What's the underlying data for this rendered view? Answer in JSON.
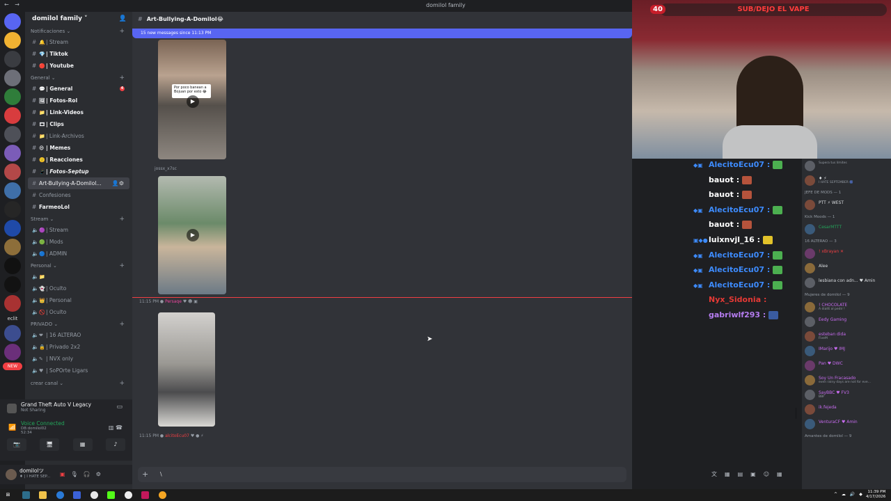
{
  "window": {
    "nav": "← →",
    "title": "domilol family"
  },
  "colors": {
    "accent": "#5865f2",
    "unread_badge": "#f23f43",
    "voice_green": "#23a55a",
    "webcam_banner_text": "#ff3b3b"
  },
  "servers": {
    "new_label": "NEW",
    "text_label": "eclit"
  },
  "guild": {
    "name": "domilol family ˅"
  },
  "categories": {
    "notificaciones": "Notificaciones ⌄",
    "general": "General ⌄",
    "stream": "Stream ⌄",
    "personal": "Personal ⌄",
    "privado": "PRIVADO ⌄",
    "crear": "crear canal ⌄"
  },
  "channels": {
    "stream": "| Stream",
    "tiktok": "| Tiktok",
    "youtube": "| Youtube",
    "general": "| General",
    "fotos_rol": "| Fotos-Rol",
    "link_videos": "| Link-Videos",
    "clips": "| Clips",
    "link_archivos": "| Link-Archivos",
    "memes": "| Memes",
    "reacciones": "| Reacciones",
    "fotos_septup": "| Fotos-Septup",
    "art_bullying": "Art-Bullying-A-Domilol...",
    "confesiones": "Confesiones",
    "farmeolol": "FarmeoLol",
    "v_stream": "| Stream",
    "v_mods": "| Mods",
    "v_admin": "| ADMIN",
    "p_oculto1": "| Oculto",
    "p_personal": "| Personal",
    "p_oculto2": "| Oculto",
    "pr_alterao": "| 16 ALTERAO",
    "pr_privado": "| Privado 2x2",
    "pr_nvx": "| NVX only",
    "pr_soporte": "| SoPOrte Ligars"
  },
  "activity": {
    "game": "Grand Theft Auto V Legacy",
    "sub": "Not Sharing"
  },
  "voice": {
    "status": "Voice Connected",
    "sub": "D8:domilol02",
    "time": "52:34"
  },
  "user": {
    "name": "domilolツ",
    "status": "♦ | I HATE SEP..."
  },
  "chat": {
    "header": "Art-Bullying-A-Domilol😂",
    "newbar": "15 new messages since 11:13 PM",
    "caption": "Por poco banean a Bojuan por esto 😂",
    "user1": "jossx_x7sc",
    "meta1_time": "11:15 PM",
    "meta1_author": "Persaqe",
    "meta2_time": "11:15 PM",
    "meta2_author": "alcitoEcu07",
    "composer_text": "\\"
  },
  "webcam": {
    "count": "40",
    "banner": "SUB/DEJO EL VAPE"
  },
  "twitch_chat": [
    {
      "badges": "◆▣",
      "user": "AlecitoEcu07 :",
      "color": "#3d8bfd",
      "emote": "#4caf50"
    },
    {
      "badges": "",
      "user": "bauot :",
      "color": "#ffffff",
      "emote": "#b5533c"
    },
    {
      "badges": "",
      "user": "bauot :",
      "color": "#ffffff",
      "emote": "#b5533c"
    },
    {
      "badges": "◆▣",
      "user": "AlecitoEcu07 :",
      "color": "#3d8bfd",
      "emote": "#4caf50"
    },
    {
      "badges": "",
      "user": "bauot :",
      "color": "#ffffff",
      "emote": "#b5533c"
    },
    {
      "badges": "▣◆●",
      "user": "luixnvjl_16 :",
      "color": "#ffffff",
      "emote": "#e2c22a"
    },
    {
      "badges": "◆▣",
      "user": "AlecitoEcu07 :",
      "color": "#3d8bfd",
      "emote": "#4caf50"
    },
    {
      "badges": "◆▣",
      "user": "AlecitoEcu07 :",
      "color": "#3d8bfd",
      "emote": "#4caf50"
    },
    {
      "badges": "◆▣",
      "user": "AlecitoEcu07 :",
      "color": "#3d8bfd",
      "emote": "#4caf50"
    },
    {
      "badges": "",
      "user": "Nyx_Sidonia :",
      "color": "#e53935",
      "emote": ""
    },
    {
      "badges": "",
      "user": "gabriwlf293 :",
      "color": "#b57cf0",
      "emote": "#3a5ba0"
    }
  ],
  "members": {
    "g1": "JEFE DE MODS — 1",
    "g2": "Kick Moods — 1",
    "g3": "16 ALTERAO — 3",
    "g4": "Mujeres de domilol — 9",
    "g5": "Amantes de domilol — 9",
    "list1": [
      {
        "name": "",
        "sub": "Supera tus límites"
      },
      {
        "name": "♦ ⚡",
        "sub": "I HATE SEPTEMBER 🎆"
      }
    ],
    "list2": [
      {
        "name": "PTT ⚡ WEST",
        "sub": ""
      }
    ],
    "list3": [
      {
        "name": "CesarMTTT",
        "sub": ""
      }
    ],
    "list4": [
      {
        "name": "! xBrayan ✕",
        "sub": ""
      },
      {
        "name": "Alee",
        "sub": ""
      },
      {
        "name": "lesbiana con adn... ♥ Amin",
        "sub": ""
      }
    ],
    "list5": [
      {
        "name": "! CHOCOLATE",
        "sub": "A dialtt al pedir !"
      },
      {
        "name": "Eedy Gaming",
        "sub": ""
      },
      {
        "name": "esteban dida",
        "sub": "FiveM"
      },
      {
        "name": "IMarijo ♥ IMJ",
        "sub": ""
      },
      {
        "name": "Pan ♥ DWC",
        "sub": ""
      },
      {
        "name": "Soy Un Fracasado",
        "sub": "even rainy days are not for eve..."
      },
      {
        "name": "SayBBC ♥ FV3",
        "sub": "BBF"
      },
      {
        "name": "ik.fejeda",
        "sub": ""
      },
      {
        "name": "VenturaCF ♥ Amin",
        "sub": ""
      }
    ]
  },
  "taskbar": {
    "tray": "^ ☁ 🔊 ◆",
    "time": "11:39 PM",
    "date": "4/17/2026"
  }
}
